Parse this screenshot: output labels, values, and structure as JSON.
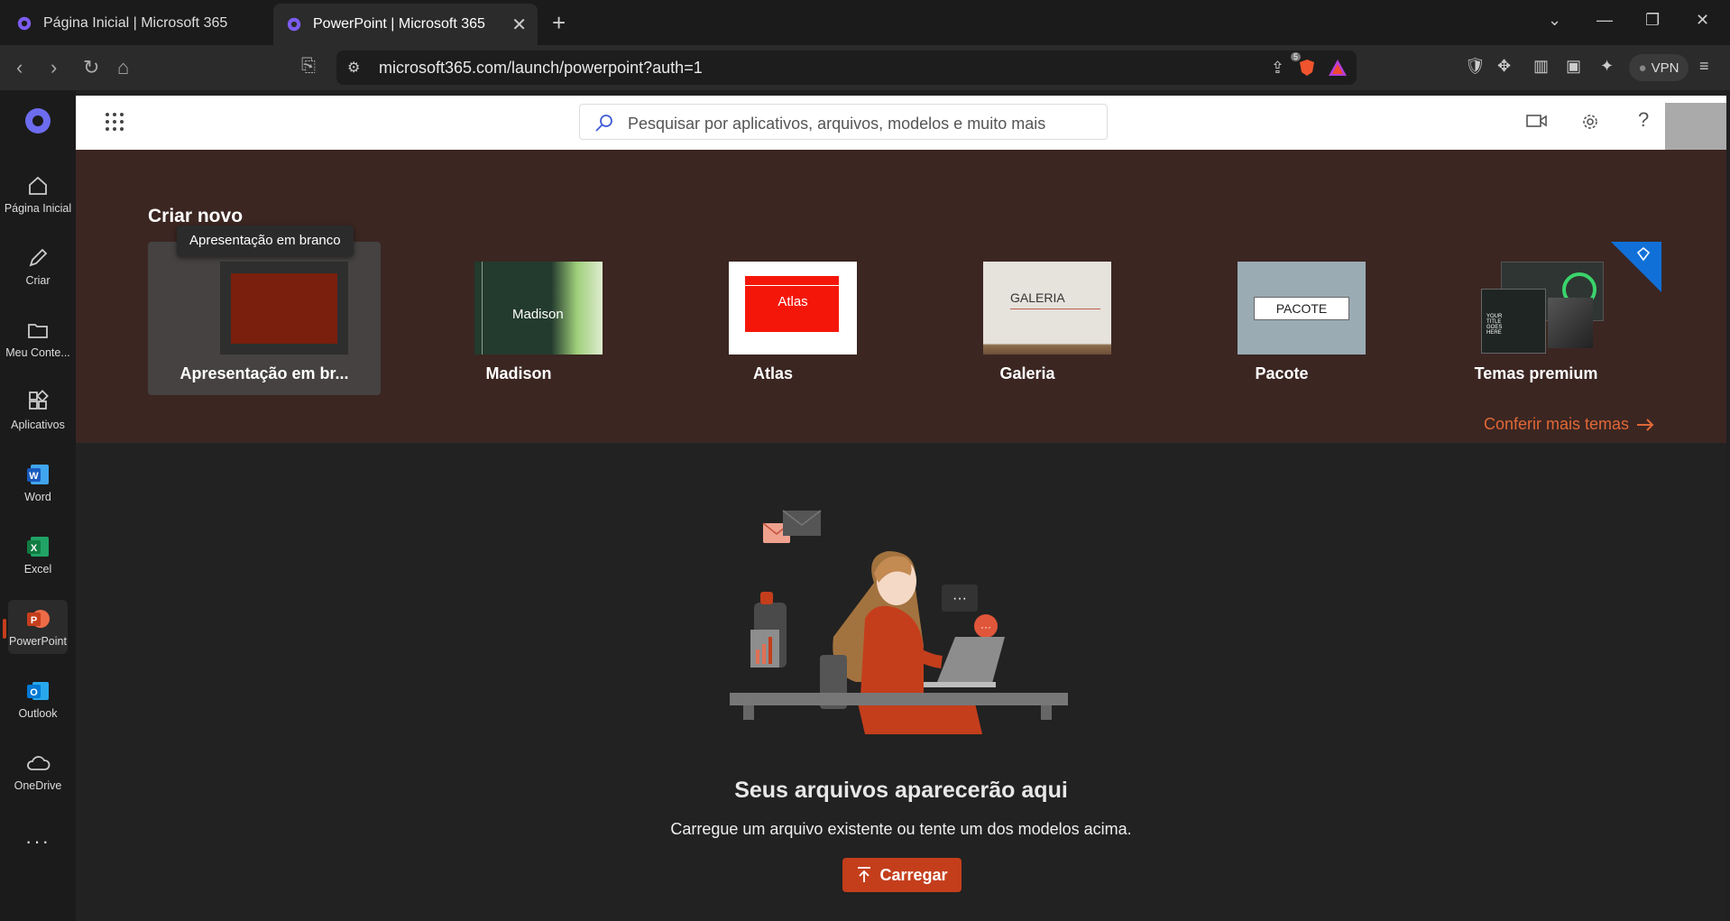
{
  "browser": {
    "tabs": [
      {
        "title": "Página Inicial | Microsoft 365"
      },
      {
        "title": "PowerPoint | Microsoft 365"
      }
    ],
    "url": "microsoft365.com/launch/powerpoint?auth=1",
    "vpn_label": "VPN",
    "brave_badge": "5"
  },
  "rail": {
    "items": [
      {
        "label": "Página Inicial"
      },
      {
        "label": "Criar"
      },
      {
        "label": "Meu Conte..."
      },
      {
        "label": "Aplicativos"
      },
      {
        "label": "Word"
      },
      {
        "label": "Excel"
      },
      {
        "label": "PowerPoint"
      },
      {
        "label": "Outlook"
      },
      {
        "label": "OneDrive"
      }
    ]
  },
  "search": {
    "placeholder": "Pesquisar por aplicativos, arquivos, modelos e muito mais"
  },
  "create": {
    "heading": "Criar novo",
    "tooltip": "Apresentação em branco",
    "templates": [
      {
        "label": "Apresentação em br..."
      },
      {
        "label": "Madison",
        "thumb_text": "Madison"
      },
      {
        "label": "Atlas",
        "thumb_text": "Atlas"
      },
      {
        "label": "Galeria",
        "thumb_text": "GALERIA"
      },
      {
        "label": "Pacote",
        "thumb_text": "PACOTE"
      },
      {
        "label": "Temas premium",
        "thumb_text": "YOUR TITLE GOES HERE"
      }
    ],
    "more_link": "Conferir mais temas"
  },
  "empty": {
    "title": "Seus arquivos aparecerão aqui",
    "subtitle": "Carregue um arquivo existente ou tente um dos modelos acima.",
    "upload_label": "Carregar"
  },
  "colors": {
    "accent": "#c43e1c",
    "link": "#e06837",
    "hero_bg": "#3b2622"
  }
}
